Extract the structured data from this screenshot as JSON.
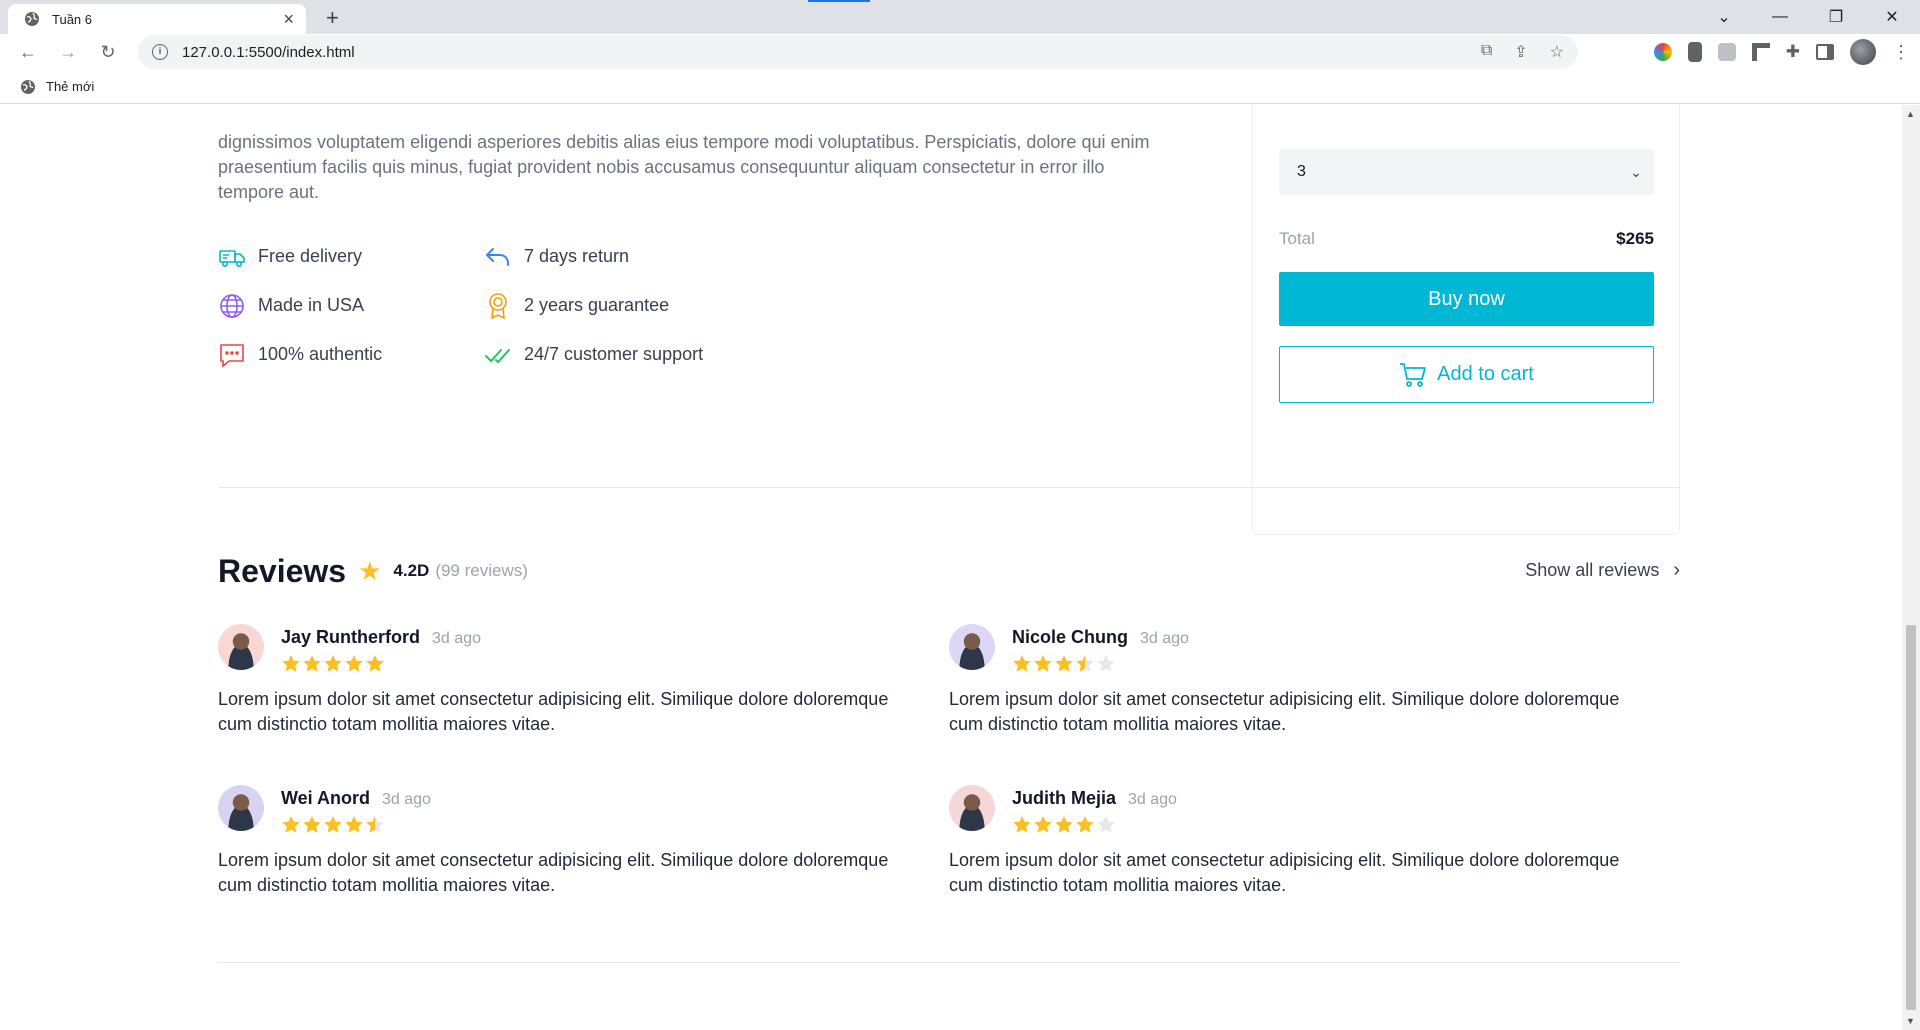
{
  "browser": {
    "tab_title": "Tuần 6",
    "url": "127.0.0.1:5500/index.html",
    "bookmark_label": "Thẻ mới"
  },
  "product": {
    "description": "dignissimos voluptatem eligendi asperiores debitis alias eius tempore modi voluptatibus. Perspiciatis, dolore qui enim praesentium facilis quis minus, fugiat provident nobis accusamus consequuntur aliquam consectetur in error illo tempore aut.",
    "features": [
      {
        "label": "Free delivery",
        "icon": "truck-icon",
        "color": "#00b8d4"
      },
      {
        "label": "7 days return",
        "icon": "return-arrow-icon",
        "color": "#3b82f6"
      },
      {
        "label": "Made in USA",
        "icon": "globe-icon",
        "color": "#8b5cf6"
      },
      {
        "label": "2 years guarantee",
        "icon": "award-icon",
        "color": "#f59e0b"
      },
      {
        "label": "100% authentic",
        "icon": "chat-icon",
        "color": "#ef4444"
      },
      {
        "label": "24/7 customer support",
        "icon": "double-check-icon",
        "color": "#22c55e"
      }
    ]
  },
  "purchase": {
    "quantity": "3",
    "total_label": "Total",
    "total_value": "$265",
    "buy_label": "Buy now",
    "cart_label": "Add to cart",
    "accent": "#00b8d4"
  },
  "reviews": {
    "title": "Reviews",
    "rating": "4.2D",
    "count": "(99 reviews)",
    "show_all": "Show all reviews",
    "items": [
      {
        "name": "Jay Runtherford",
        "time": "3d ago",
        "stars": 5,
        "text": "Lorem ipsum dolor sit amet consectetur adipisicing elit. Similique dolore doloremque cum distinctio totam mollitia maiores vitae.",
        "avatar_bg": "#f9d7d3"
      },
      {
        "name": "Nicole Chung",
        "time": "3d ago",
        "stars": 3.5,
        "text": "Lorem ipsum dolor sit amet consectetur adipisicing elit. Similique dolore doloremque cum distinctio totam mollitia maiores vitae.",
        "avatar_bg": "#dcd6f7"
      },
      {
        "name": "Wei Anord",
        "time": "3d ago",
        "stars": 4.5,
        "text": "Lorem ipsum dolor sit amet consectetur adipisicing elit. Similique dolore doloremque cum distinctio totam mollitia maiores vitae.",
        "avatar_bg": "#d8d3f0"
      },
      {
        "name": "Judith Mejia",
        "time": "3d ago",
        "stars": 4,
        "text": "Lorem ipsum dolor sit amet consectetur adipisicing elit. Similique dolore doloremque cum distinctio totam mollitia maiores vitae.",
        "avatar_bg": "#f6d6d6"
      }
    ]
  }
}
